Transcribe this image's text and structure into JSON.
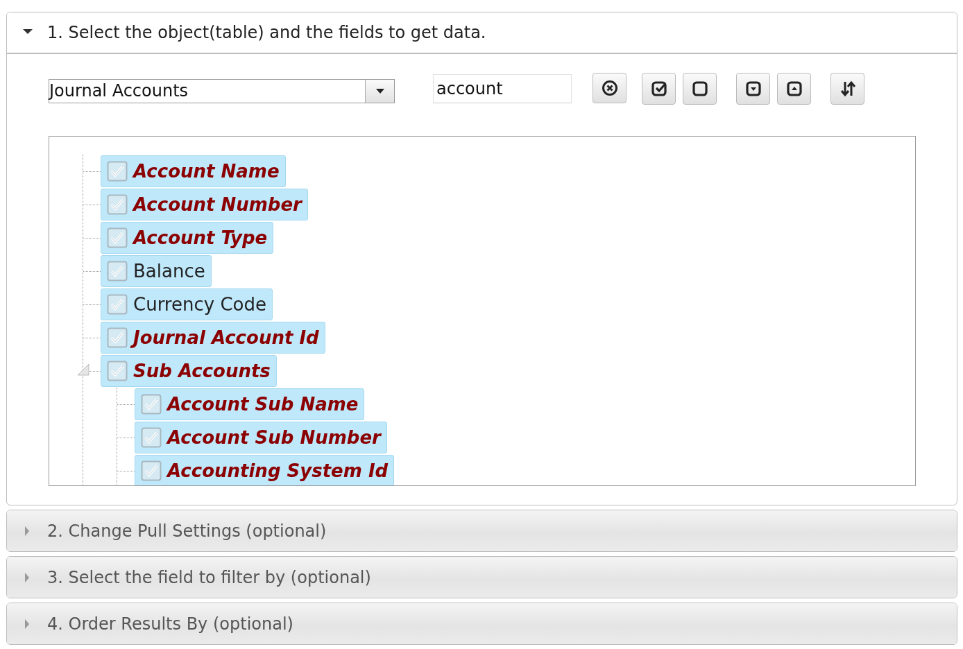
{
  "sections": [
    {
      "title": "1. Select the object(table) and the fields to get data.",
      "expanded": true,
      "object_select": {
        "value": "Journal Accounts"
      },
      "search": {
        "value": "account"
      },
      "fields": [
        {
          "label": "Account Name",
          "checked": true,
          "selected": true,
          "matched": true
        },
        {
          "label": "Account Number",
          "checked": true,
          "selected": true,
          "matched": true
        },
        {
          "label": "Account Type",
          "checked": true,
          "selected": true,
          "matched": true
        },
        {
          "label": "Balance",
          "checked": true,
          "selected": true,
          "matched": false
        },
        {
          "label": "Currency Code",
          "checked": true,
          "selected": true,
          "matched": false
        },
        {
          "label": "Journal Account Id",
          "checked": true,
          "selected": true,
          "matched": true
        },
        {
          "label": "Sub Accounts",
          "checked": true,
          "selected": true,
          "matched": true,
          "expanded": true,
          "children": [
            {
              "label": "Account Sub Name",
              "checked": true,
              "selected": true,
              "matched": true
            },
            {
              "label": "Account Sub Number",
              "checked": true,
              "selected": true,
              "matched": true
            },
            {
              "label": "Accounting System Id",
              "checked": true,
              "selected": true,
              "matched": true
            }
          ]
        }
      ]
    },
    {
      "title": "2. Change Pull Settings (optional)",
      "expanded": false
    },
    {
      "title": "3. Select the field to filter by (optional)",
      "expanded": false
    },
    {
      "title": "4. Order Results By (optional)",
      "expanded": false
    }
  ]
}
